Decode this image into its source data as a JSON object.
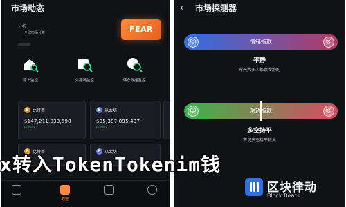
{
  "left": {
    "title": "市场动态",
    "sub_label": "分析",
    "sub_text": "全球市场分析",
    "fear_badge": "FEAR",
    "features": [
      {
        "label": "链上监控",
        "icon": "home-search-icon"
      },
      {
        "label": "交易所监控",
        "icon": "exchange-search-icon"
      },
      {
        "label": "爆仓数据监控",
        "icon": "liquidation-search-icon"
      }
    ],
    "cards": [
      {
        "name": "比特币",
        "symbol": "B",
        "price": "$147,211.033,598",
        "change": "Bullish",
        "color": "#f7931a"
      },
      {
        "name": "以太坊",
        "symbol": "E",
        "price": "$35,387,895,437",
        "change": "Bullish",
        "color": "#627eea"
      }
    ],
    "row2": [
      {
        "name": "比特币",
        "symbol": "B",
        "color": "#f7931a"
      },
      {
        "name": "以太坊",
        "symbol": "E",
        "color": "#627eea"
      }
    ],
    "tabs": [
      {
        "label": ""
      },
      {
        "label": ""
      },
      {
        "label": "数据"
      },
      {
        "label": ""
      }
    ]
  },
  "overlay": {
    "text": "x转入TokenTokenim钱"
  },
  "right": {
    "back_glyph": "‹",
    "title": "市场探测器",
    "emotion": {
      "label": "情绪指数",
      "state": "平静",
      "desc": "今天大多人都很冷静的",
      "color_start": "#2f6fe6",
      "color_end": "#b43b63"
    },
    "trend": {
      "label": "期货指数",
      "state": "多空持平",
      "desc": "市场多空持平较大",
      "color_start": "#39b54a",
      "color_end": "#d94b63"
    },
    "brand": {
      "cn": "区块律动",
      "en": "Block Beats"
    }
  }
}
